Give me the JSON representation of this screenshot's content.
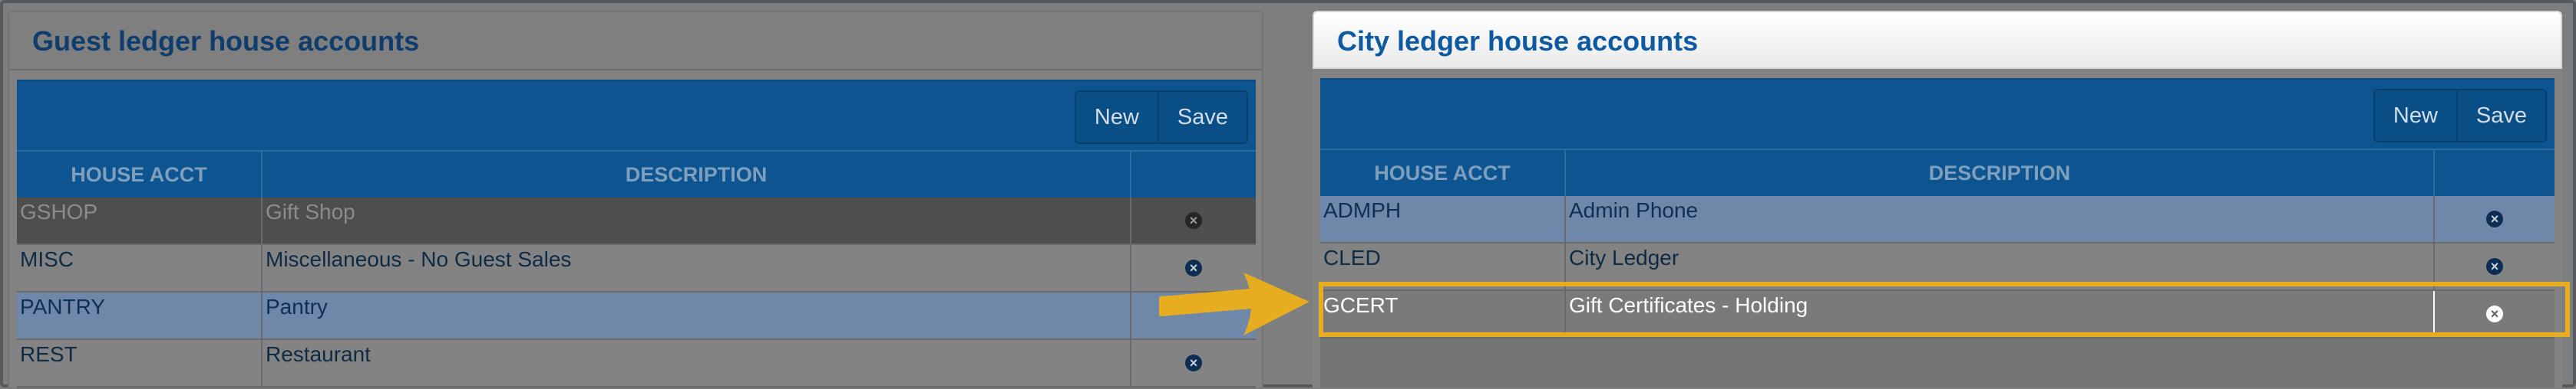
{
  "left_panel": {
    "title": "Guest ledger house accounts",
    "toolbar": {
      "new_label": "New",
      "save_label": "Save"
    },
    "columns": [
      "HOUSE ACCT",
      "DESCRIPTION",
      ""
    ],
    "rows": [
      {
        "code": "GSHOP",
        "description": "Gift Shop",
        "style": "dark"
      },
      {
        "code": "MISC",
        "description": "Miscellaneous - No Guest Sales",
        "style": "gray"
      },
      {
        "code": "PANTRY",
        "description": "Pantry",
        "style": "blue"
      },
      {
        "code": "REST",
        "description": "Restaurant",
        "style": "gray"
      }
    ]
  },
  "right_panel": {
    "title": "City ledger house accounts",
    "toolbar": {
      "new_label": "New",
      "save_label": "Save"
    },
    "columns": [
      "HOUSE ACCT",
      "DESCRIPTION",
      ""
    ],
    "rows": [
      {
        "code": "ADMPH",
        "description": "Admin Phone",
        "style": "blue"
      },
      {
        "code": "CLED",
        "description": "City Ledger",
        "style": "gray"
      },
      {
        "code": "GCERT",
        "description": "Gift Certificates - Holding",
        "style": "hl"
      }
    ]
  },
  "icons": {
    "delete": "close-circle-icon",
    "annotation": "right-arrow-icon"
  },
  "colors": {
    "accent_blue": "#0c5591",
    "highlight": "#e7ad21",
    "title_blue": "#0d5aa3"
  }
}
